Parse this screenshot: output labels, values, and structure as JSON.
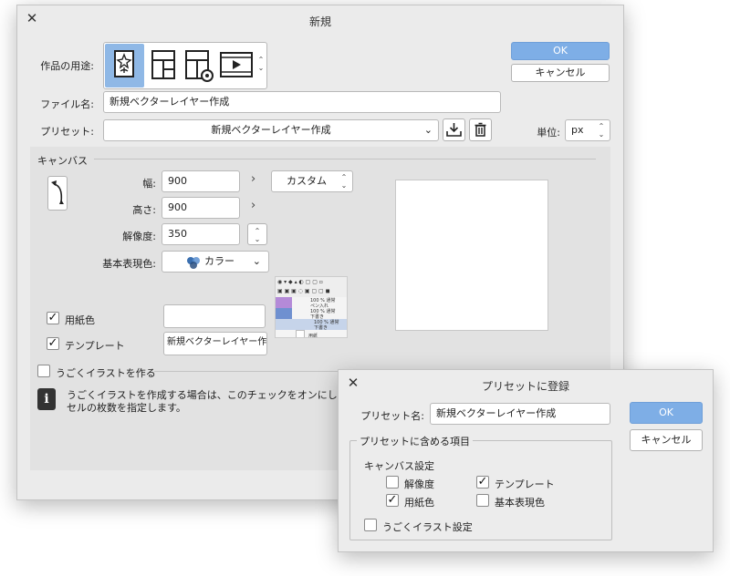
{
  "main": {
    "title": "新規",
    "usage_label": "作品の用途:",
    "usage_modes": [
      "illustration-icon",
      "comic-icon",
      "comic-settings-icon",
      "animation-icon"
    ],
    "filename_label": "ファイル名:",
    "filename_value": "新規ベクターレイヤー作成",
    "preset_label": "プリセット:",
    "preset_value": "新規ベクターレイヤー作成",
    "unit_label": "単位:",
    "unit_value": "px",
    "ok": "OK",
    "cancel": "キャンセル",
    "canvas_header": "キャンバス",
    "width_label": "幅:",
    "width_value": "900",
    "height_label": "高さ:",
    "height_value": "900",
    "size_preset": "カスタム",
    "resolution_label": "解像度:",
    "resolution_value": "350",
    "color_label": "基本表現色:",
    "color_value": "カラー",
    "paper_label": "用紙色",
    "paper_checked": true,
    "template_label": "テンプレート",
    "template_checked": true,
    "template_value": "新規ベクターレイヤー作成",
    "animation_label": "うごくイラストを作る",
    "animation_checked": false,
    "info_text": "うごくイラストを作成する場合は、このチェックをオンにして",
    "info_text2": "セルの枚数を指定します。",
    "layers": {
      "row1a": "100 % 通常",
      "row1b": "ペン入れ",
      "row2a": "100 % 通常",
      "row2b": "下書き",
      "row3a": "100 % 通常",
      "row3b": "下書き",
      "row4": "用紙"
    },
    "colors": {
      "accent": "#7eaee6",
      "window": "#ebebeb",
      "panel": "#e2e2e2"
    }
  },
  "preset_dialog": {
    "title": "プリセットに登録",
    "name_label": "プリセット名:",
    "name_value": "新規ベクターレイヤー作成",
    "ok": "OK",
    "cancel": "キャンセル",
    "group_label": "プリセットに含める項目",
    "canvas_settings_label": "キャンバス設定",
    "resolution": {
      "label": "解像度",
      "checked": false
    },
    "template": {
      "label": "テンプレート",
      "checked": true
    },
    "paper": {
      "label": "用紙色",
      "checked": true
    },
    "color_mode": {
      "label": "基本表現色",
      "checked": false
    },
    "animation": {
      "label": "うごくイラスト設定",
      "checked": false
    }
  }
}
